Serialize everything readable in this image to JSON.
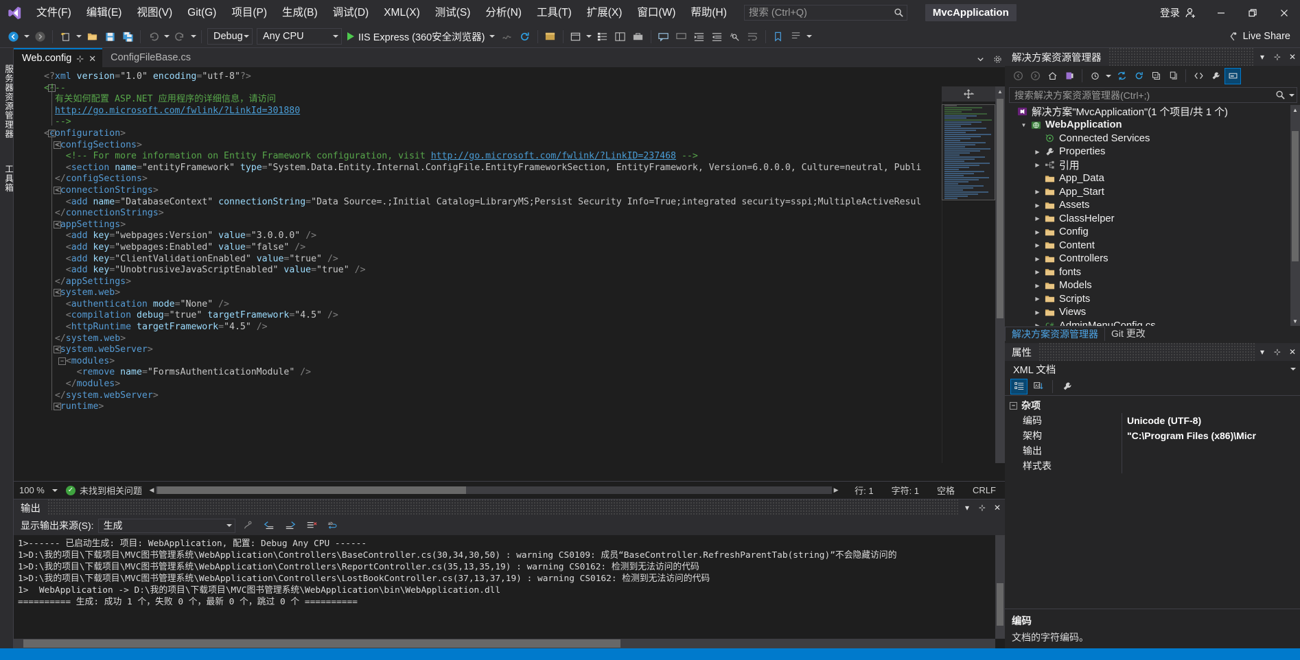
{
  "window": {
    "app_title": "MvcApplication",
    "signin_label": "登录",
    "minimize_label": "最小化",
    "restore_label": "还原",
    "close_label": "关闭"
  },
  "menubar": {
    "items": [
      {
        "label": "文件(F)"
      },
      {
        "label": "编辑(E)"
      },
      {
        "label": "视图(V)"
      },
      {
        "label": "Git(G)"
      },
      {
        "label": "项目(P)"
      },
      {
        "label": "生成(B)"
      },
      {
        "label": "调试(D)"
      },
      {
        "label": "XML(X)"
      },
      {
        "label": "测试(S)"
      },
      {
        "label": "分析(N)"
      },
      {
        "label": "工具(T)"
      },
      {
        "label": "扩展(X)"
      },
      {
        "label": "窗口(W)"
      },
      {
        "label": "帮助(H)"
      }
    ],
    "search_placeholder": "搜索 (Ctrl+Q)",
    "search_value": ""
  },
  "toolbar": {
    "configuration": "Debug",
    "platform": "Any CPU",
    "run_target": "IIS Express (360安全浏览器)",
    "live_share": "Live Share"
  },
  "left_rail": {
    "tabs": [
      "服务器资源管理器",
      "工具箱"
    ]
  },
  "editor": {
    "tabs": [
      {
        "label": "Web.config",
        "active": true
      },
      {
        "label": "ConfigFileBase.cs",
        "active": false
      }
    ],
    "code_lines": [
      {
        "indent": 0,
        "fold": null,
        "segments": [
          {
            "t": "br",
            "s": "<?"
          },
          {
            "t": "pi",
            "s": "xml"
          },
          {
            "t": "attr",
            "s": " version"
          },
          {
            "t": "br",
            "s": "="
          },
          {
            "t": "str",
            "s": "\"1.0\""
          },
          {
            "t": "attr",
            "s": " encoding"
          },
          {
            "t": "br",
            "s": "="
          },
          {
            "t": "str",
            "s": "\"utf-8\""
          },
          {
            "t": "br",
            "s": "?>"
          }
        ]
      },
      {
        "indent": 0,
        "fold": "minus",
        "segments": [
          {
            "t": "cmt",
            "s": "<!--"
          }
        ]
      },
      {
        "indent": 1,
        "fold": null,
        "segments": [
          {
            "t": "cmt",
            "s": "有关如何配置 ASP.NET 应用程序的详细信息，请访问"
          }
        ]
      },
      {
        "indent": 1,
        "fold": null,
        "segments": [
          {
            "t": "link",
            "s": "http://go.microsoft.com/fwlink/?LinkId=301880"
          }
        ]
      },
      {
        "indent": 1,
        "fold": null,
        "segments": [
          {
            "t": "cmt",
            "s": "-->"
          }
        ]
      },
      {
        "indent": 0,
        "fold": "minus",
        "segments": [
          {
            "t": "br",
            "s": "<"
          },
          {
            "t": "tag",
            "s": "configuration"
          },
          {
            "t": "br",
            "s": ">"
          }
        ]
      },
      {
        "indent": 1,
        "fold": "minus",
        "segments": [
          {
            "t": "br",
            "s": "<"
          },
          {
            "t": "tag",
            "s": "configSections"
          },
          {
            "t": "br",
            "s": ">"
          }
        ]
      },
      {
        "indent": 2,
        "fold": null,
        "segments": [
          {
            "t": "cmt",
            "s": "<!-- For more information on Entity Framework configuration, visit "
          },
          {
            "t": "link",
            "s": "http://go.microsoft.com/fwlink/?LinkID=237468"
          },
          {
            "t": "cmt",
            "s": " -->"
          }
        ]
      },
      {
        "indent": 2,
        "fold": null,
        "segments": [
          {
            "t": "br",
            "s": "<"
          },
          {
            "t": "tag",
            "s": "section"
          },
          {
            "t": "attr",
            "s": " name"
          },
          {
            "t": "br",
            "s": "="
          },
          {
            "t": "str",
            "s": "\"entityFramework\""
          },
          {
            "t": "attr",
            "s": " type"
          },
          {
            "t": "br",
            "s": "="
          },
          {
            "t": "str",
            "s": "\"System.Data.Entity.Internal.ConfigFile.EntityFrameworkSection, EntityFramework, Version=6.0.0.0, Culture=neutral, Publi"
          }
        ]
      },
      {
        "indent": 1,
        "fold": null,
        "segments": [
          {
            "t": "br",
            "s": "</"
          },
          {
            "t": "tag",
            "s": "configSections"
          },
          {
            "t": "br",
            "s": ">"
          }
        ]
      },
      {
        "indent": 1,
        "fold": "minus",
        "segments": [
          {
            "t": "br",
            "s": "<"
          },
          {
            "t": "tag",
            "s": "connectionStrings"
          },
          {
            "t": "br",
            "s": ">"
          }
        ]
      },
      {
        "indent": 2,
        "fold": null,
        "segments": [
          {
            "t": "br",
            "s": "<"
          },
          {
            "t": "tag",
            "s": "add"
          },
          {
            "t": "attr",
            "s": " name"
          },
          {
            "t": "br",
            "s": "="
          },
          {
            "t": "str",
            "s": "\"DatabaseContext\""
          },
          {
            "t": "attr",
            "s": " connectionString"
          },
          {
            "t": "br",
            "s": "="
          },
          {
            "t": "str",
            "s": "\"Data Source=.;Initial Catalog=LibraryMS;Persist Security Info=True;integrated security=sspi;MultipleActiveResul"
          }
        ]
      },
      {
        "indent": 1,
        "fold": null,
        "segments": [
          {
            "t": "br",
            "s": "</"
          },
          {
            "t": "tag",
            "s": "connectionStrings"
          },
          {
            "t": "br",
            "s": ">"
          }
        ]
      },
      {
        "indent": 1,
        "fold": "minus",
        "segments": [
          {
            "t": "br",
            "s": "<"
          },
          {
            "t": "tag",
            "s": "appSettings"
          },
          {
            "t": "br",
            "s": ">"
          }
        ]
      },
      {
        "indent": 2,
        "fold": null,
        "segments": [
          {
            "t": "br",
            "s": "<"
          },
          {
            "t": "tag",
            "s": "add"
          },
          {
            "t": "attr",
            "s": " key"
          },
          {
            "t": "br",
            "s": "="
          },
          {
            "t": "str",
            "s": "\"webpages:Version\""
          },
          {
            "t": "attr",
            "s": " value"
          },
          {
            "t": "br",
            "s": "="
          },
          {
            "t": "str",
            "s": "\"3.0.0.0\""
          },
          {
            "t": "br",
            "s": " />"
          }
        ]
      },
      {
        "indent": 2,
        "fold": null,
        "segments": [
          {
            "t": "br",
            "s": "<"
          },
          {
            "t": "tag",
            "s": "add"
          },
          {
            "t": "attr",
            "s": " key"
          },
          {
            "t": "br",
            "s": "="
          },
          {
            "t": "str",
            "s": "\"webpages:Enabled\""
          },
          {
            "t": "attr",
            "s": " value"
          },
          {
            "t": "br",
            "s": "="
          },
          {
            "t": "str",
            "s": "\"false\""
          },
          {
            "t": "br",
            "s": " />"
          }
        ]
      },
      {
        "indent": 2,
        "fold": null,
        "segments": [
          {
            "t": "br",
            "s": "<"
          },
          {
            "t": "tag",
            "s": "add"
          },
          {
            "t": "attr",
            "s": " key"
          },
          {
            "t": "br",
            "s": "="
          },
          {
            "t": "str",
            "s": "\"ClientValidationEnabled\""
          },
          {
            "t": "attr",
            "s": " value"
          },
          {
            "t": "br",
            "s": "="
          },
          {
            "t": "str",
            "s": "\"true\""
          },
          {
            "t": "br",
            "s": " />"
          }
        ]
      },
      {
        "indent": 2,
        "fold": null,
        "segments": [
          {
            "t": "br",
            "s": "<"
          },
          {
            "t": "tag",
            "s": "add"
          },
          {
            "t": "attr",
            "s": " key"
          },
          {
            "t": "br",
            "s": "="
          },
          {
            "t": "str",
            "s": "\"UnobtrusiveJavaScriptEnabled\""
          },
          {
            "t": "attr",
            "s": " value"
          },
          {
            "t": "br",
            "s": "="
          },
          {
            "t": "str",
            "s": "\"true\""
          },
          {
            "t": "br",
            "s": " />"
          }
        ]
      },
      {
        "indent": 1,
        "fold": null,
        "segments": [
          {
            "t": "br",
            "s": "</"
          },
          {
            "t": "tag",
            "s": "appSettings"
          },
          {
            "t": "br",
            "s": ">"
          }
        ]
      },
      {
        "indent": 1,
        "fold": "minus",
        "segments": [
          {
            "t": "br",
            "s": "<"
          },
          {
            "t": "tag",
            "s": "system.web"
          },
          {
            "t": "br",
            "s": ">"
          }
        ]
      },
      {
        "indent": 2,
        "fold": null,
        "segments": [
          {
            "t": "br",
            "s": "<"
          },
          {
            "t": "tag",
            "s": "authentication"
          },
          {
            "t": "attr",
            "s": " mode"
          },
          {
            "t": "br",
            "s": "="
          },
          {
            "t": "str",
            "s": "\"None\""
          },
          {
            "t": "br",
            "s": " />"
          }
        ]
      },
      {
        "indent": 2,
        "fold": null,
        "segments": [
          {
            "t": "br",
            "s": "<"
          },
          {
            "t": "tag",
            "s": "compilation"
          },
          {
            "t": "attr",
            "s": " debug"
          },
          {
            "t": "br",
            "s": "="
          },
          {
            "t": "str",
            "s": "\"true\""
          },
          {
            "t": "attr",
            "s": " targetFramework"
          },
          {
            "t": "br",
            "s": "="
          },
          {
            "t": "str",
            "s": "\"4.5\""
          },
          {
            "t": "br",
            "s": " />"
          }
        ]
      },
      {
        "indent": 2,
        "fold": null,
        "segments": [
          {
            "t": "br",
            "s": "<"
          },
          {
            "t": "tag",
            "s": "httpRuntime"
          },
          {
            "t": "attr",
            "s": " targetFramework"
          },
          {
            "t": "br",
            "s": "="
          },
          {
            "t": "str",
            "s": "\"4.5\""
          },
          {
            "t": "br",
            "s": " />"
          }
        ]
      },
      {
        "indent": 1,
        "fold": null,
        "segments": [
          {
            "t": "br",
            "s": "</"
          },
          {
            "t": "tag",
            "s": "system.web"
          },
          {
            "t": "br",
            "s": ">"
          }
        ]
      },
      {
        "indent": 1,
        "fold": "minus",
        "segments": [
          {
            "t": "br",
            "s": "<"
          },
          {
            "t": "tag",
            "s": "system.webServer"
          },
          {
            "t": "br",
            "s": ">"
          }
        ]
      },
      {
        "indent": 2,
        "fold": "minus",
        "segments": [
          {
            "t": "br",
            "s": "<"
          },
          {
            "t": "tag",
            "s": "modules"
          },
          {
            "t": "br",
            "s": ">"
          }
        ]
      },
      {
        "indent": 3,
        "fold": null,
        "segments": [
          {
            "t": "br",
            "s": "<"
          },
          {
            "t": "tag",
            "s": "remove"
          },
          {
            "t": "attr",
            "s": " name"
          },
          {
            "t": "br",
            "s": "="
          },
          {
            "t": "str",
            "s": "\"FormsAuthenticationModule\""
          },
          {
            "t": "br",
            "s": " />"
          }
        ]
      },
      {
        "indent": 2,
        "fold": null,
        "segments": [
          {
            "t": "br",
            "s": "</"
          },
          {
            "t": "tag",
            "s": "modules"
          },
          {
            "t": "br",
            "s": ">"
          }
        ]
      },
      {
        "indent": 1,
        "fold": null,
        "segments": [
          {
            "t": "br",
            "s": "</"
          },
          {
            "t": "tag",
            "s": "system.webServer"
          },
          {
            "t": "br",
            "s": ">"
          }
        ]
      },
      {
        "indent": 1,
        "fold": "minus",
        "segments": [
          {
            "t": "br",
            "s": "<"
          },
          {
            "t": "tag",
            "s": "runtime"
          },
          {
            "t": "br",
            "s": ">"
          }
        ]
      }
    ],
    "status": {
      "zoom": "100 %",
      "issues": "未找到相关问题",
      "line": "行: 1",
      "column": "字符: 1",
      "spaces": "空格",
      "eol": "CRLF"
    }
  },
  "output": {
    "title": "输出",
    "source_label": "显示输出来源(S):",
    "source_value": "生成",
    "lines": [
      "1>------ 已启动生成: 项目: WebApplication, 配置: Debug Any CPU ------",
      "1>D:\\我的项目\\下载项目\\MVC图书管理系统\\WebApplication\\Controllers\\BaseController.cs(30,34,30,50) : warning CS0109: 成员“BaseController.RefreshParentTab(string)”不会隐藏访问的",
      "1>D:\\我的项目\\下载项目\\MVC图书管理系统\\WebApplication\\Controllers\\ReportController.cs(35,13,35,19) : warning CS0162: 检测到无法访问的代码",
      "1>D:\\我的项目\\下载项目\\MVC图书管理系统\\WebApplication\\Controllers\\LostBookController.cs(37,13,37,19) : warning CS0162: 检测到无法访问的代码",
      "1>  WebApplication -> D:\\我的项目\\下载项目\\MVC图书管理系统\\WebApplication\\bin\\WebApplication.dll",
      "========== 生成: 成功 1 个，失败 0 个，最新 0 个，跳过 0 个 =========="
    ]
  },
  "solution_explorer": {
    "title": "解决方案资源管理器",
    "search_placeholder": "搜索解决方案资源管理器(Ctrl+;)",
    "search_value": "",
    "tree": [
      {
        "label": "解决方案\"MvcApplication\"(1 个项目/共 1 个)",
        "icon": "solution-icon",
        "indent": 0,
        "twisty": "",
        "bold": false
      },
      {
        "label": "WebApplication",
        "icon": "project-web-icon",
        "indent": 1,
        "twisty": "down",
        "bold": true
      },
      {
        "label": "Connected Services",
        "icon": "connected-services-icon",
        "indent": 2,
        "twisty": "",
        "bold": false
      },
      {
        "label": "Properties",
        "icon": "wrench-icon",
        "indent": 2,
        "twisty": "right",
        "bold": false
      },
      {
        "label": "引用",
        "icon": "references-icon",
        "indent": 2,
        "twisty": "right",
        "bold": false
      },
      {
        "label": "App_Data",
        "icon": "folder-icon",
        "indent": 2,
        "twisty": "",
        "bold": false
      },
      {
        "label": "App_Start",
        "icon": "folder-icon",
        "indent": 2,
        "twisty": "right",
        "bold": false
      },
      {
        "label": "Assets",
        "icon": "folder-icon",
        "indent": 2,
        "twisty": "right",
        "bold": false
      },
      {
        "label": "ClassHelper",
        "icon": "folder-icon",
        "indent": 2,
        "twisty": "right",
        "bold": false
      },
      {
        "label": "Config",
        "icon": "folder-icon",
        "indent": 2,
        "twisty": "right",
        "bold": false
      },
      {
        "label": "Content",
        "icon": "folder-icon",
        "indent": 2,
        "twisty": "right",
        "bold": false
      },
      {
        "label": "Controllers",
        "icon": "folder-icon",
        "indent": 2,
        "twisty": "right",
        "bold": false
      },
      {
        "label": "fonts",
        "icon": "folder-icon",
        "indent": 2,
        "twisty": "right",
        "bold": false
      },
      {
        "label": "Models",
        "icon": "folder-icon",
        "indent": 2,
        "twisty": "right",
        "bold": false
      },
      {
        "label": "Scripts",
        "icon": "folder-icon",
        "indent": 2,
        "twisty": "right",
        "bold": false
      },
      {
        "label": "Views",
        "icon": "folder-icon",
        "indent": 2,
        "twisty": "right",
        "bold": false
      },
      {
        "label": "AdminMenuConfig.cs",
        "icon": "csharp-icon",
        "indent": 2,
        "twisty": "right",
        "bold": false
      }
    ],
    "dock_tabs": [
      {
        "label": "解决方案资源管理器",
        "active": true
      },
      {
        "label": "Git 更改",
        "active": false
      }
    ]
  },
  "properties": {
    "title": "属性",
    "selected_object": "XML 文档",
    "group": "杂项",
    "rows": [
      {
        "name": "编码",
        "value": "Unicode (UTF-8)"
      },
      {
        "name": "架构",
        "value": "\"C:\\Program Files (x86)\\Micr"
      },
      {
        "name": "输出",
        "value": ""
      },
      {
        "name": "样式表",
        "value": ""
      }
    ],
    "desc_title": "编码",
    "desc_body": "文档的字符编码。"
  },
  "colors": {
    "accent": "#007acc",
    "chrome": "#2d2d30",
    "editor_bg": "#1e1e1e",
    "panel_bg": "#252526"
  }
}
